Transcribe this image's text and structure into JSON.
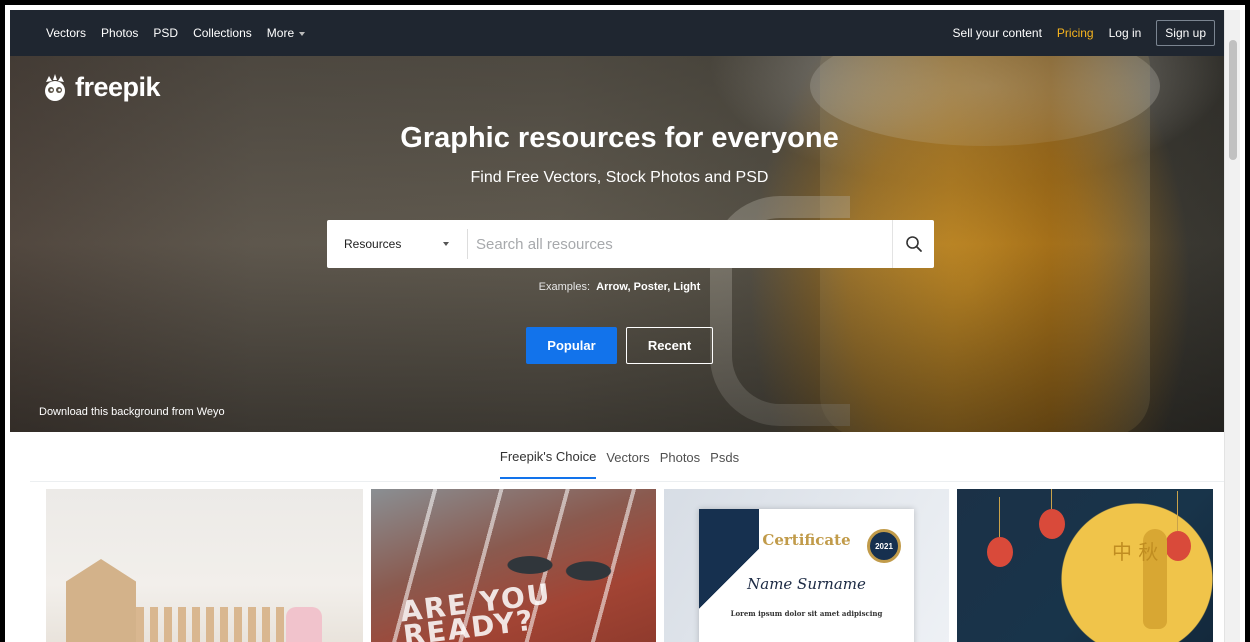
{
  "nav": {
    "left": [
      {
        "label": "Vectors"
      },
      {
        "label": "Photos"
      },
      {
        "label": "PSD"
      },
      {
        "label": "Collections"
      },
      {
        "label": "More"
      }
    ],
    "sell": "Sell your content",
    "pricing": "Pricing",
    "login": "Log in",
    "signup": "Sign up",
    "pricing_color": "#f8b51e"
  },
  "brand": {
    "name": "freepik",
    "logo_icon": "freepik-mascot-icon"
  },
  "hero": {
    "title": "Graphic resources for everyone",
    "subtitle": "Find Free Vectors, Stock Photos and PSD",
    "search": {
      "type_value": "Resources",
      "placeholder": "Search all resources",
      "button_icon": "search-icon"
    },
    "examples_label": "Examples:",
    "examples": [
      "Arrow",
      "Poster",
      "Light"
    ],
    "buttons": {
      "popular": "Popular",
      "recent": "Recent"
    },
    "credit": "Download this background from Weyo",
    "accent_color": "#1273eb"
  },
  "tabs": [
    "Freepik's Choice",
    "Vectors",
    "Photos",
    "Psds"
  ],
  "cards": {
    "card2_text": "ARE YOU READY?",
    "card3": {
      "title": "Certificate",
      "name": "Name Surname",
      "lorem": "Lorem ipsum dolor sit amet adipiscing",
      "year": "2021"
    },
    "card4_text": "中 秋"
  }
}
